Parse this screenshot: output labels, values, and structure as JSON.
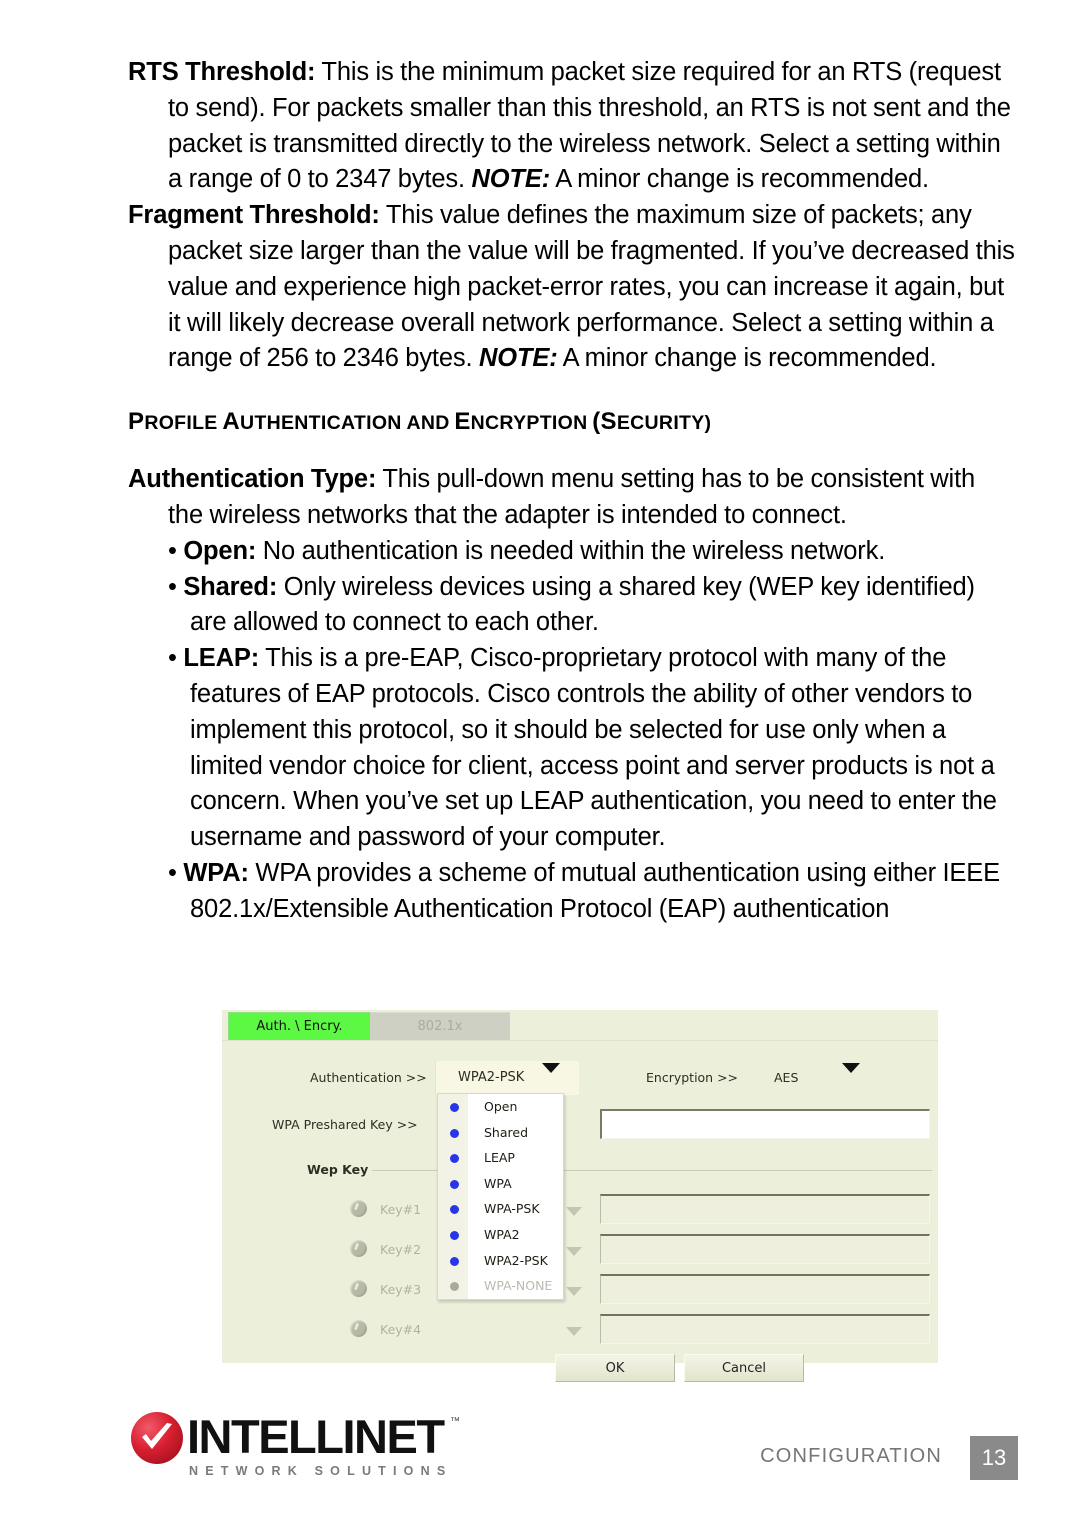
{
  "document": {
    "paragraphs": [
      {
        "id": "rts-threshold",
        "term": "RTS Threshold:",
        "body_1": " This is the minimum packet size required for an RTS (request to send). For packets smaller than this threshold, an RTS is not sent and the packet is transmitted directly to the wireless network. Select a setting within a range of 0 to 2347 bytes. ",
        "note": "NOTE:",
        "body_2": " A minor change is recommended."
      },
      {
        "id": "fragment-threshold",
        "term": "Fragment Threshold:",
        "body_1": " This value defines the maximum size of packets; any packet size larger than the value will be fragmented. If you’ve decreased this value and experience high packet-error rates, you can increase it again, but it will likely decrease overall network performance. Select a setting within a range of 256 to 2346 bytes. ",
        "note": "NOTE:",
        "body_2": " A minor change is recommended."
      }
    ],
    "section_heading": {
      "words": [
        {
          "cap": "P",
          "rest": "ROFILE"
        },
        {
          "cap": "A",
          "rest": "UTHENTICATION"
        },
        {
          "cap": "",
          "rest": "AND"
        },
        {
          "cap": "E",
          "rest": "NCRYPTION"
        },
        {
          "cap": "(S",
          "rest": "ECURITY)"
        }
      ],
      "plain": "PROFILE AUTHENTICATION AND ENCRYPTION (SECURITY)"
    },
    "auth_type": {
      "term": "Authentication Type:",
      "body": " This pull-down menu setting has to be consistent with the wireless networks that the adapter is intended to connect."
    },
    "bullets": [
      {
        "id": "open",
        "marker": "• ",
        "term": "Open:",
        "body": " No authentication is needed within the wireless network."
      },
      {
        "id": "shared",
        "marker": "• ",
        "term": "Shared:",
        "body": " Only wireless devices using a shared key (WEP key identified) are allowed to connect to each other."
      },
      {
        "id": "leap",
        "marker": "• ",
        "term": "LEAP:",
        "body": " This is a pre-EAP, Cisco-proprietary protocol with many of the features of EAP protocols. Cisco controls the ability of other vendors to implement this protocol, so it should be selected for use only when a limited vendor choice for client, access point and server products is not a concern. When you’ve set up LEAP authentication, you need to enter the username and password of your computer."
      },
      {
        "id": "wpa",
        "marker": "• ",
        "term": "WPA:",
        "body": " WPA provides a scheme of mutual authentication using either IEEE 802.1x/Extensible Authentication Protocol (EAP) authentication"
      }
    ]
  },
  "app_screenshot": {
    "tabs": [
      {
        "label": "Auth. \\ Encry.",
        "state": "active"
      },
      {
        "label": "802.1x",
        "state": "disabled"
      }
    ],
    "fields": {
      "authentication_label": "Authentication >>",
      "authentication_value": "WPA2-PSK",
      "encryption_label": "Encryption >>",
      "encryption_value": "AES",
      "wpa_preshared_key_label": "WPA Preshared Key >>",
      "wpa_preshared_key_value": "",
      "wep_key_group_label": "Wep Key"
    },
    "dropdown_options": [
      {
        "label": "Open",
        "disabled": false
      },
      {
        "label": "Shared",
        "disabled": false
      },
      {
        "label": "LEAP",
        "disabled": false
      },
      {
        "label": "WPA",
        "disabled": false
      },
      {
        "label": "WPA-PSK",
        "disabled": false
      },
      {
        "label": "WPA2",
        "disabled": false
      },
      {
        "label": "WPA2-PSK",
        "disabled": false
      },
      {
        "label": "WPA-NONE",
        "disabled": true
      }
    ],
    "wep_keys": [
      {
        "label": "Key#1",
        "value": "",
        "disabled": true
      },
      {
        "label": "Key#2",
        "value": "",
        "disabled": true
      },
      {
        "label": "Key#3",
        "value": "",
        "disabled": true
      },
      {
        "label": "Key#4",
        "value": "",
        "disabled": true
      }
    ],
    "buttons": {
      "ok": "OK",
      "cancel": "Cancel"
    },
    "colors": {
      "panel_bg": "#ecefd9",
      "active_tab": "#5df843",
      "inactive_tab": "#cdd0c2",
      "bullet": "#2b35e8"
    }
  },
  "footer": {
    "brand": "INTELLINET",
    "trademark": "™",
    "tagline": "NETWORK SOLUTIONS",
    "caption": "CONFIGURATION",
    "page_number": "13",
    "badge_color": "#8a8a8a"
  }
}
